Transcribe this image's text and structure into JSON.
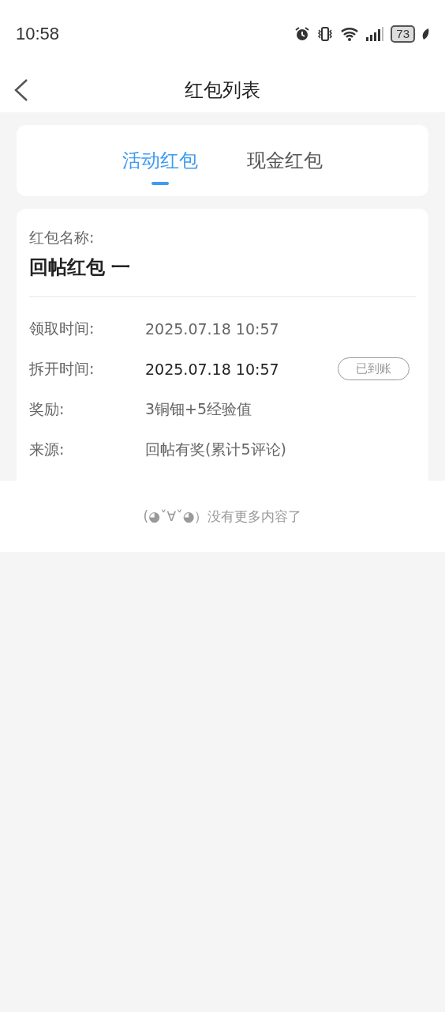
{
  "status_bar": {
    "time": "10:58",
    "battery": "73"
  },
  "header": {
    "title": "红包列表"
  },
  "tabs": [
    {
      "label": "活动红包",
      "selected": true
    },
    {
      "label": "现金红包",
      "selected": false
    }
  ],
  "records": [
    {
      "name_label": "红包名称:",
      "name": "回帖红包 一",
      "fields": [
        {
          "label": "领取时间:",
          "value": "2025.07.18 10:57",
          "highlighted": false
        },
        {
          "label": "拆开时间:",
          "value": "2025.07.18 10:57",
          "highlighted": true,
          "badge": "已到账"
        },
        {
          "label": "奖励:",
          "value": "3铜钿+5经验值",
          "highlighted": false
        },
        {
          "label": "来源:",
          "value": "回帖有奖(累计5评论)",
          "highlighted": false
        }
      ]
    }
  ],
  "footer": {
    "text": "(◕ˇ∀ˇ◕）没有更多内容了"
  }
}
